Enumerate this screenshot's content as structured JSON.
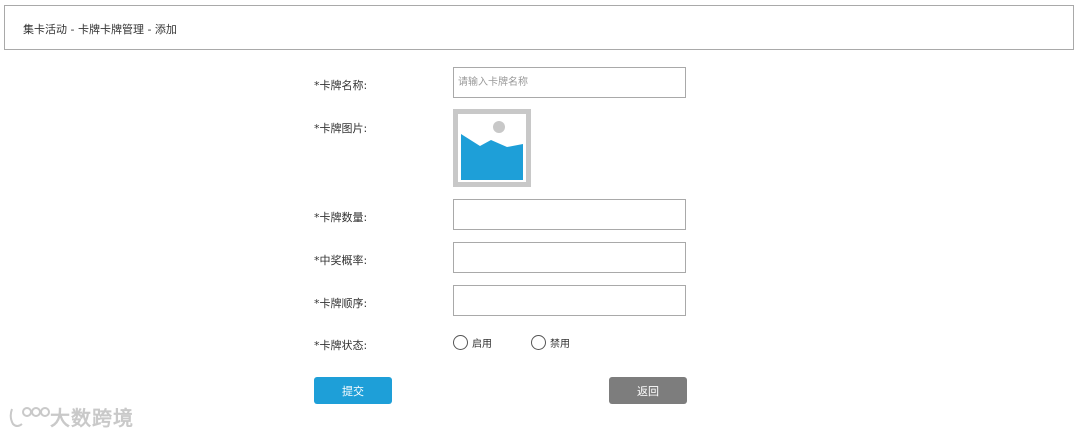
{
  "header": {
    "breadcrumb": "集卡活动 - 卡牌卡牌管理 - 添加"
  },
  "form": {
    "name_label": "*卡牌名称:",
    "name_placeholder": "请输入卡牌名称",
    "name_value": "",
    "image_label": "*卡牌图片:",
    "quantity_label": "*卡牌数量:",
    "quantity_value": "",
    "probability_label": "*中奖概率:",
    "probability_value": "",
    "order_label": "*卡牌顺序:",
    "order_value": "",
    "status_label": "*卡牌状态:",
    "status_options": [
      "启用",
      "禁用"
    ]
  },
  "buttons": {
    "submit": "提交",
    "back": "返回"
  },
  "watermark": {
    "text": "大数跨境"
  },
  "colors": {
    "accent": "#1e9fd8",
    "back_button": "#7d7d7d",
    "border": "#a9a9a9"
  }
}
